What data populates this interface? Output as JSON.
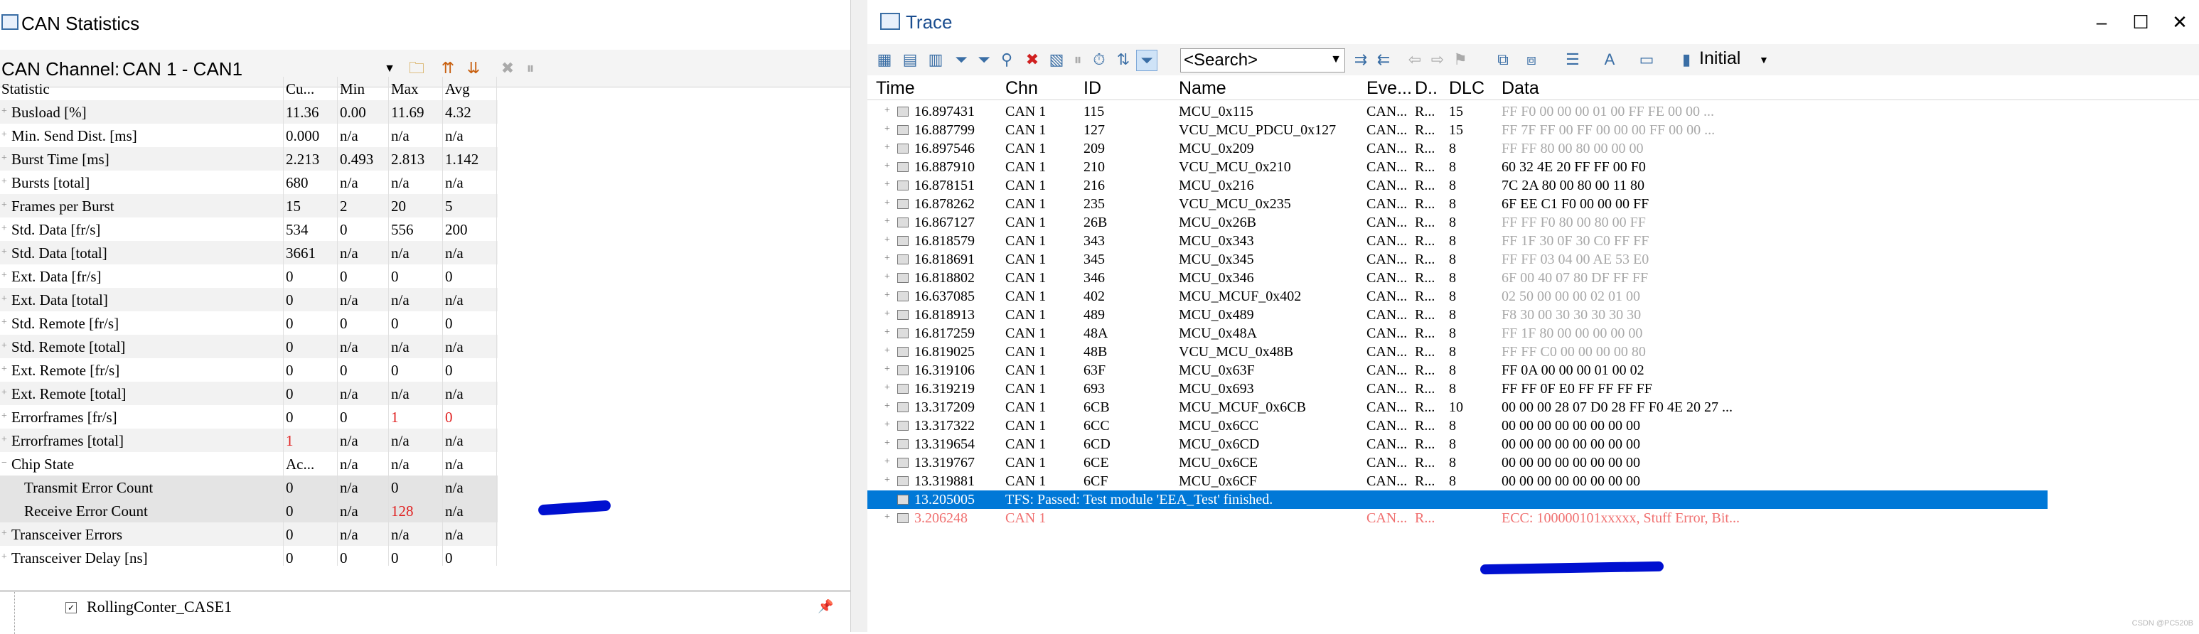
{
  "stats": {
    "title": "CAN Statistics",
    "channel_label": "CAN Channel:",
    "channel_value": "CAN 1 - CAN1",
    "headers": [
      "Statistic",
      "Cu...",
      "Min",
      "Max",
      "Avg"
    ],
    "rows": [
      {
        "name": "Busload [%]",
        "cur": "11.36",
        "min": "0.00",
        "max": "11.69",
        "avg": "4.32",
        "expand": true
      },
      {
        "name": "Min. Send Dist. [ms]",
        "cur": "0.000",
        "min": "n/a",
        "max": "n/a",
        "avg": "n/a",
        "expand": true
      },
      {
        "name": "Burst Time [ms]",
        "cur": "2.213",
        "min": "0.493",
        "max": "2.813",
        "avg": "1.142",
        "expand": false
      },
      {
        "name": "Bursts [total]",
        "cur": "680",
        "min": "n/a",
        "max": "n/a",
        "avg": "n/a",
        "expand": true
      },
      {
        "name": "Frames per Burst",
        "cur": "15",
        "min": "2",
        "max": "20",
        "avg": "5",
        "expand": false
      },
      {
        "name": "Std. Data [fr/s]",
        "cur": "534",
        "min": "0",
        "max": "556",
        "avg": "200",
        "expand": true
      },
      {
        "name": "Std. Data [total]",
        "cur": "3661",
        "min": "n/a",
        "max": "n/a",
        "avg": "n/a",
        "expand": true
      },
      {
        "name": "Ext. Data [fr/s]",
        "cur": "0",
        "min": "0",
        "max": "0",
        "avg": "0",
        "expand": true
      },
      {
        "name": "Ext. Data [total]",
        "cur": "0",
        "min": "n/a",
        "max": "n/a",
        "avg": "n/a",
        "expand": true
      },
      {
        "name": "Std. Remote [fr/s]",
        "cur": "0",
        "min": "0",
        "max": "0",
        "avg": "0",
        "expand": true
      },
      {
        "name": "Std. Remote [total]",
        "cur": "0",
        "min": "n/a",
        "max": "n/a",
        "avg": "n/a",
        "expand": true
      },
      {
        "name": "Ext. Remote [fr/s]",
        "cur": "0",
        "min": "0",
        "max": "0",
        "avg": "0",
        "expand": true
      },
      {
        "name": "Ext. Remote [total]",
        "cur": "0",
        "min": "n/a",
        "max": "n/a",
        "avg": "n/a",
        "expand": true
      },
      {
        "name": "Errorframes [fr/s]",
        "cur": "0",
        "min": "0",
        "max": "1",
        "avg": "0",
        "expand": true,
        "max_red": true,
        "avg_red": true
      },
      {
        "name": "Errorframes [total]",
        "cur": "1",
        "min": "n/a",
        "max": "n/a",
        "avg": "n/a",
        "expand": true,
        "cur_red": true
      },
      {
        "name": "Chip State",
        "cur": "Ac...",
        "min": "n/a",
        "max": "n/a",
        "avg": "n/a",
        "expand": true,
        "collapse": true
      },
      {
        "name": "Transmit Error Count",
        "cur": "0",
        "min": "n/a",
        "max": "0",
        "avg": "n/a",
        "child": true
      },
      {
        "name": "Receive Error Count",
        "cur": "0",
        "min": "n/a",
        "max": "128",
        "avg": "n/a",
        "child": true,
        "max_red": true
      },
      {
        "name": "Transceiver Errors",
        "cur": "0",
        "min": "n/a",
        "max": "n/a",
        "avg": "n/a",
        "expand": true
      },
      {
        "name": "Transceiver Delay [ns]",
        "cur": "0",
        "min": "0",
        "max": "0",
        "avg": "0",
        "expand": false
      }
    ],
    "bottom_items": [
      "RollingConter_CASE1"
    ]
  },
  "trace": {
    "title": "Trace",
    "search_placeholder": "<Search>",
    "view_label": "Initial",
    "headers": [
      "Time",
      "Chn",
      "ID",
      "Name",
      "Eve...",
      "D..",
      "DLC",
      "Data"
    ],
    "rows": [
      {
        "time": "16.897431",
        "chn": "CAN 1",
        "id": "115",
        "name": "MCU_0x115",
        "eve": "CAN...",
        "d": "R...",
        "dlc": "15",
        "data": "FF F0 00 00 00 01 00 FF FE 00 00  ...",
        "data_gray": true
      },
      {
        "time": "16.887799",
        "chn": "CAN 1",
        "id": "127",
        "name": "VCU_MCU_PDCU_0x127",
        "eve": "CAN...",
        "d": "R...",
        "dlc": "15",
        "data": "FF 7F FF 00 FF 00 00 00 FF 00 00  ...",
        "data_gray": true
      },
      {
        "time": "16.897546",
        "chn": "CAN 1",
        "id": "209",
        "name": "MCU_0x209",
        "eve": "CAN...",
        "d": "R...",
        "dlc": "8",
        "data": "FF FF 80 00 80 00 00 00",
        "data_gray": true
      },
      {
        "time": "16.887910",
        "chn": "CAN 1",
        "id": "210",
        "name": "VCU_MCU_0x210",
        "eve": "CAN...",
        "d": "R...",
        "dlc": "8",
        "data": "60 32 4E 20 FF FF 00 F0",
        "data_gray": false
      },
      {
        "time": "16.878151",
        "chn": "CAN 1",
        "id": "216",
        "name": "MCU_0x216",
        "eve": "CAN...",
        "d": "R...",
        "dlc": "8",
        "data": "7C 2A 80 00 80 00 11 80",
        "data_gray": false
      },
      {
        "time": "16.878262",
        "chn": "CAN 1",
        "id": "235",
        "name": "VCU_MCU_0x235",
        "eve": "CAN...",
        "d": "R...",
        "dlc": "8",
        "data": "6F EE C1 F0 00 00 00 FF",
        "data_gray": false
      },
      {
        "time": "16.867127",
        "chn": "CAN 1",
        "id": "26B",
        "name": "MCU_0x26B",
        "eve": "CAN...",
        "d": "R...",
        "dlc": "8",
        "data": "FF FF F0 80 00 80 00 FF",
        "data_gray": true
      },
      {
        "time": "16.818579",
        "chn": "CAN 1",
        "id": "343",
        "name": "MCU_0x343",
        "eve": "CAN...",
        "d": "R...",
        "dlc": "8",
        "data": "FF 1F 30 0F 30 C0 FF FF",
        "data_gray": true
      },
      {
        "time": "16.818691",
        "chn": "CAN 1",
        "id": "345",
        "name": "MCU_0x345",
        "eve": "CAN...",
        "d": "R...",
        "dlc": "8",
        "data": "FF FF 03 04 00 AE 53 E0",
        "data_gray": true
      },
      {
        "time": "16.818802",
        "chn": "CAN 1",
        "id": "346",
        "name": "MCU_0x346",
        "eve": "CAN...",
        "d": "R...",
        "dlc": "8",
        "data": "6F 00 40 07 80 DF FF FF",
        "data_gray": true
      },
      {
        "time": "16.637085",
        "chn": "CAN 1",
        "id": "402",
        "name": "MCU_MCUF_0x402",
        "eve": "CAN...",
        "d": "R...",
        "dlc": "8",
        "data": "02 50 00 00 00 02 01 00",
        "data_gray": true
      },
      {
        "time": "16.818913",
        "chn": "CAN 1",
        "id": "489",
        "name": "MCU_0x489",
        "eve": "CAN...",
        "d": "R...",
        "dlc": "8",
        "data": "F8 30 00 30 30 30 30 30",
        "data_gray": true
      },
      {
        "time": "16.817259",
        "chn": "CAN 1",
        "id": "48A",
        "name": "MCU_0x48A",
        "eve": "CAN...",
        "d": "R...",
        "dlc": "8",
        "data": "FF 1F 80 00 00 00 00 00",
        "data_gray": true
      },
      {
        "time": "16.819025",
        "chn": "CAN 1",
        "id": "48B",
        "name": "VCU_MCU_0x48B",
        "eve": "CAN...",
        "d": "R...",
        "dlc": "8",
        "data": "FF FF C0 00 00 00 00 80",
        "data_gray": true
      },
      {
        "time": "16.319106",
        "chn": "CAN 1",
        "id": "63F",
        "name": "MCU_0x63F",
        "eve": "CAN...",
        "d": "R...",
        "dlc": "8",
        "data": "FF 0A 00 00 00 01 00 02",
        "data_gray": false
      },
      {
        "time": "16.319219",
        "chn": "CAN 1",
        "id": "693",
        "name": "MCU_0x693",
        "eve": "CAN...",
        "d": "R...",
        "dlc": "8",
        "data": "FF FF 0F E0 FF FF FF FF",
        "data_gray": false
      },
      {
        "time": "13.317209",
        "chn": "CAN 1",
        "id": "6CB",
        "name": "MCU_MCUF_0x6CB",
        "eve": "CAN...",
        "d": "R...",
        "dlc": "10",
        "data": "00 00 00 28 07 D0 28 FF F0 4E 20 27  ...",
        "data_gray": false
      },
      {
        "time": "13.317322",
        "chn": "CAN 1",
        "id": "6CC",
        "name": "MCU_0x6CC",
        "eve": "CAN...",
        "d": "R...",
        "dlc": "8",
        "data": "00 00 00 00 00 00 00 00",
        "data_gray": false
      },
      {
        "time": "13.319654",
        "chn": "CAN 1",
        "id": "6CD",
        "name": "MCU_0x6CD",
        "eve": "CAN...",
        "d": "R...",
        "dlc": "8",
        "data": "00 00 00 00 00 00 00 00",
        "data_gray": false
      },
      {
        "time": "13.319767",
        "chn": "CAN 1",
        "id": "6CE",
        "name": "MCU_0x6CE",
        "eve": "CAN...",
        "d": "R...",
        "dlc": "8",
        "data": "00 00 00 00 00 00 00 00",
        "data_gray": false
      },
      {
        "time": "13.319881",
        "chn": "CAN 1",
        "id": "6CF",
        "name": "MCU_0x6CF",
        "eve": "CAN...",
        "d": "R...",
        "dlc": "8",
        "data": "00 00 00 00 00 00 00 00",
        "data_gray": false
      }
    ],
    "selected_row": {
      "time": "13.205005",
      "text": "TFS: Passed: Test module 'EEA_Test' finished."
    },
    "error_row": {
      "time": "3.206248",
      "chn": "CAN 1",
      "eve": "CAN...",
      "d": "R...",
      "data": "ECC: 100000101xxxxx, Stuff Error, Bit..."
    }
  },
  "watermark": "CSDN @PC520B",
  "colors": {
    "selection": "#0078d7",
    "error": "#e02020",
    "scribble": "#0010d0"
  }
}
